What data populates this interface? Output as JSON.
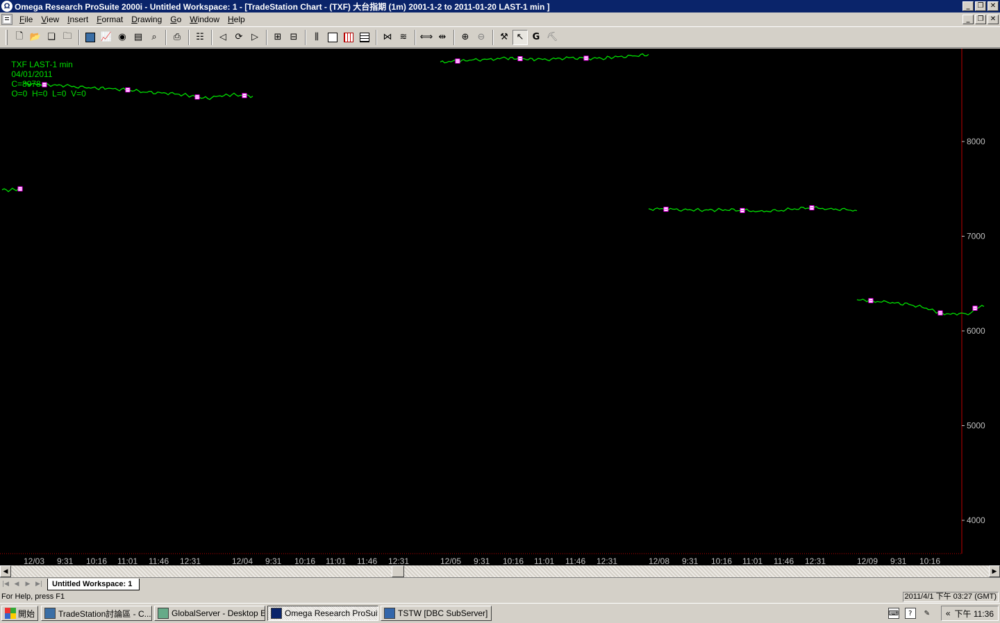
{
  "window": {
    "title": "Omega Research ProSuite 2000i - Untitled Workspace:  1 - [TradeStation Chart - (TXF) 大台指期 (1m) 2001-1-2 to 2011-01-20 LAST-1 min ]",
    "app_icon": "omega-icon"
  },
  "menu": {
    "items": [
      "File",
      "View",
      "Insert",
      "Format",
      "Drawing",
      "Go",
      "Window",
      "Help"
    ]
  },
  "toolbar": {
    "icons": [
      "new-icon",
      "open-icon",
      "open-workspace-icon",
      "folder-icon",
      "print-setup-icon",
      "chart-icon",
      "radar-icon",
      "page-icon",
      "find-icon",
      "print-icon",
      "properties-icon",
      "back-icon",
      "refresh-icon",
      "forward-icon",
      "insert-analysis-icon",
      "format-analysis-icon",
      "bar-type-icon",
      "window-icon",
      "grid-icon",
      "table-icon",
      "indicator-icon",
      "strategy-icon",
      "spread-icon",
      "compress-icon",
      "zoom-in-icon",
      "zoom-out-icon",
      "tools-icon",
      "pointer-icon",
      "g-icon",
      "disabled-icon"
    ]
  },
  "chart": {
    "legend": {
      "symbol": "TXF LAST-1 min",
      "date": "04/01/2011",
      "close": "C=8978",
      "ohlc": "O=0  H=0  L=0  V=0"
    },
    "price_axis_ticks": [
      "8000",
      "7000",
      "6000",
      "5000",
      "4000"
    ],
    "time_axis_ticks": [
      "12/03",
      "9:31",
      "10:16",
      "11:01",
      "11:46",
      "12:31",
      "12/04",
      "9:31",
      "10:16",
      "11:01",
      "11:46",
      "12:31",
      "12/05",
      "9:31",
      "10:16",
      "11:01",
      "11:46",
      "12:31",
      "12/08",
      "9:31",
      "10:16",
      "11:01",
      "11:46",
      "12:31",
      "12/09",
      "9:31",
      "10:16"
    ],
    "line_color": "#00e000",
    "marker_color": "#ff00ff",
    "right_border_color": "#c00000"
  },
  "chart_data": {
    "type": "line",
    "title": "TXF LAST-1 min",
    "ylim": [
      3650,
      8980
    ],
    "y_ticks": [
      8000,
      7000,
      6000,
      5000,
      4000
    ],
    "grid": false,
    "series": [
      {
        "name": "",
        "segments": [
          {
            "session": "12/02",
            "points": [
              [
                0,
                7490
              ],
              [
                12,
                7488
              ],
              [
                26,
                7500
              ]
            ]
          },
          {
            "session": "12/03",
            "points": [
              [
                0,
                8610
              ],
              [
                30,
                8600
              ],
              [
                60,
                8590
              ],
              [
                88,
                8570
              ],
              [
                120,
                8560
              ],
              [
                150,
                8545
              ],
              [
                178,
                8520
              ],
              [
                205,
                8510
              ],
              [
                230,
                8495
              ],
              [
                250,
                8470
              ],
              [
                265,
                8455
              ],
              [
                280,
                8480
              ],
              [
                300,
                8495
              ],
              [
                318,
                8485
              ],
              [
                330,
                8480
              ]
            ]
          },
          {
            "session": "12/04",
            "points": [
              [
                0,
                8840
              ],
              [
                25,
                8850
              ],
              [
                45,
                8860
              ],
              [
                70,
                8870
              ],
              [
                95,
                8880
              ],
              [
                115,
                8875
              ],
              [
                138,
                8865
              ],
              [
                160,
                8870
              ],
              [
                185,
                8885
              ],
              [
                210,
                8880
              ],
              [
                232,
                8878
              ],
              [
                255,
                8895
              ],
              [
                280,
                8905
              ],
              [
                300,
                8920
              ]
            ]
          },
          {
            "session": "12/05",
            "points": [
              [
                0,
                7290
              ],
              [
                25,
                7285
              ],
              [
                50,
                7280
              ],
              [
                80,
                7275
              ],
              [
                110,
                7280
              ],
              [
                135,
                7272
              ],
              [
                160,
                7265
              ],
              [
                185,
                7268
              ],
              [
                210,
                7290
              ],
              [
                235,
                7300
              ],
              [
                260,
                7290
              ],
              [
                285,
                7280
              ],
              [
                300,
                7270
              ]
            ]
          },
          {
            "session": "12/08",
            "points": [
              [
                0,
                6330
              ],
              [
                20,
                6320
              ],
              [
                45,
                6300
              ],
              [
                75,
                6280
              ],
              [
                100,
                6240
              ],
              [
                120,
                6190
              ],
              [
                135,
                6175
              ],
              [
                150,
                6190
              ],
              [
                160,
                6170
              ],
              [
                170,
                6240
              ],
              [
                180,
                6270
              ],
              [
                183,
                6260
              ]
            ]
          }
        ]
      }
    ]
  },
  "scrollbar": {
    "left_arrow": "◀",
    "right_arrow": "▶"
  },
  "tabs": {
    "nav": [
      "|◀",
      "◀",
      "▶",
      "▶|"
    ],
    "workspace_tab": "Untitled Workspace:  1"
  },
  "status": {
    "help": "For Help, press F1",
    "datetime": "2011/4/1 下午 03:27 (GMT)"
  },
  "taskbar": {
    "start": "開始",
    "tasks": [
      {
        "label": "TradeStation討論區 - C...",
        "icon": "browser-icon"
      },
      {
        "label": "GlobalServer - Desktop E...",
        "icon": "server-icon"
      },
      {
        "label": "Omega Research ProSuit...",
        "icon": "omega-icon",
        "active": true
      },
      {
        "label": "TSTW [DBC SubServer]",
        "icon": "subserver-icon"
      }
    ],
    "tray_time": "下午 11:36",
    "tray_chevron": "«"
  }
}
